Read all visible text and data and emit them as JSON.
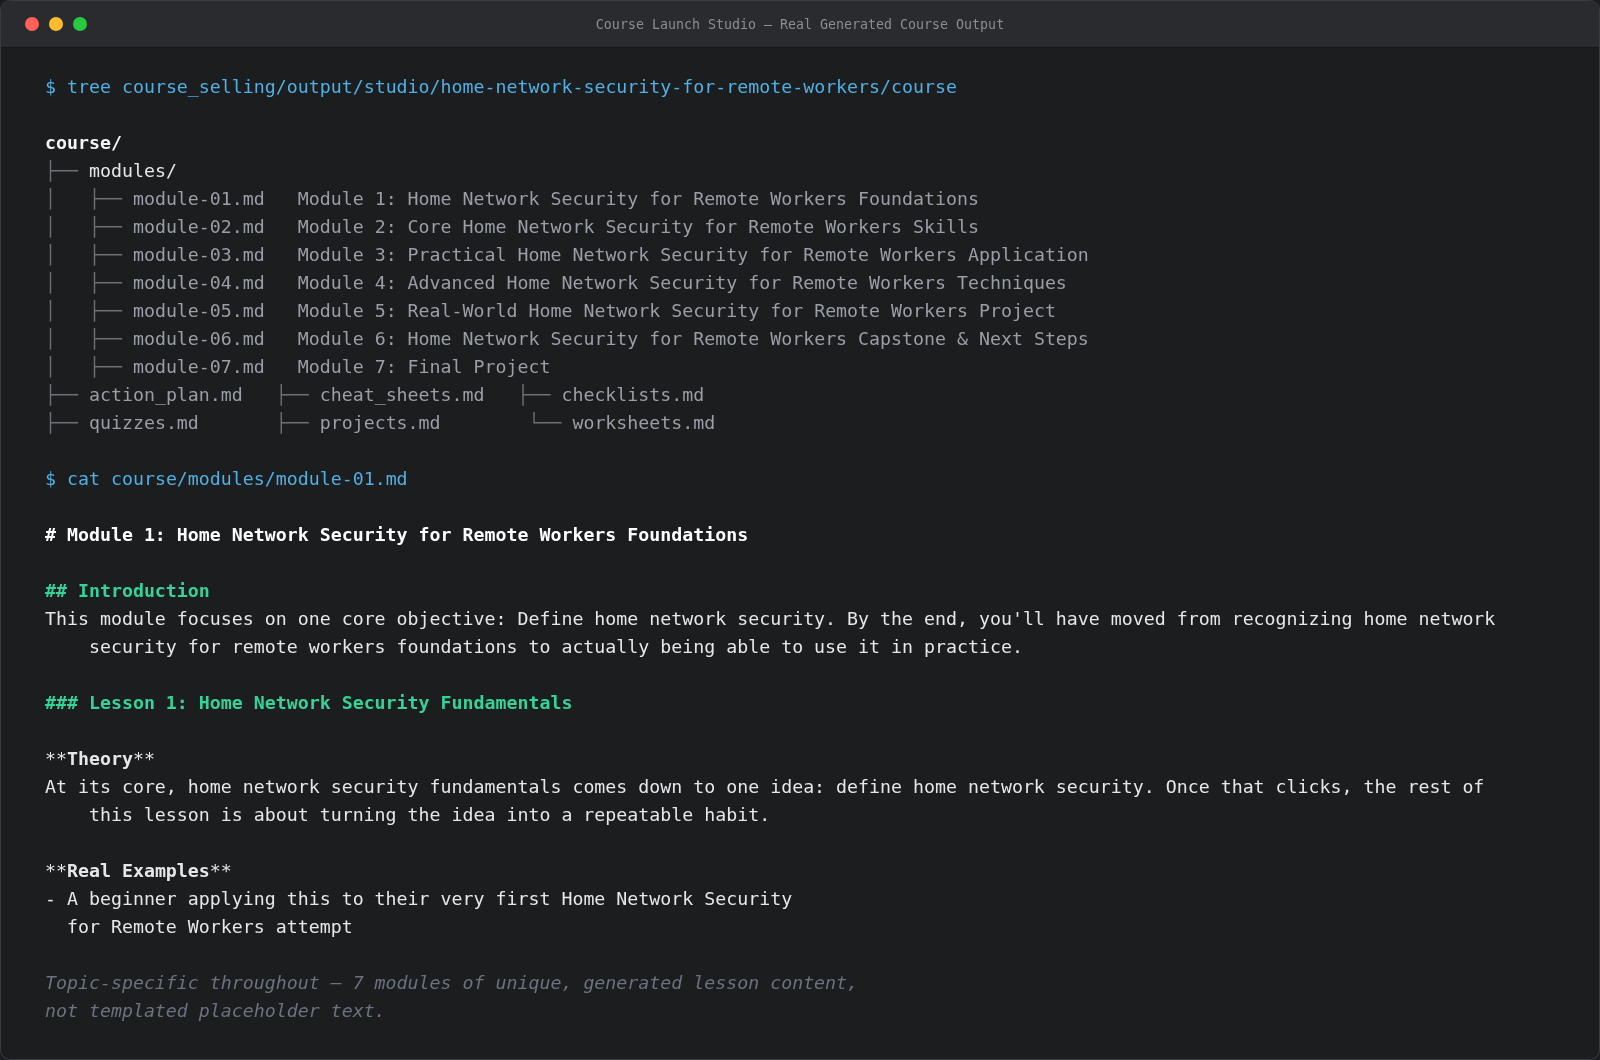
{
  "window": {
    "title": "Course Launch Studio — Real Generated Course Output"
  },
  "blocks": [
    {
      "kind": "command",
      "prompt": "$",
      "text": "tree course_selling/output/studio/home-network-security-for-remote-workers/course"
    },
    {
      "kind": "root",
      "text": "course/"
    },
    {
      "kind": "dir",
      "branch": "├──",
      "name": "modules/"
    },
    {
      "kind": "file",
      "branch": "│   ├──",
      "name": "module-01.md",
      "description": "Module 1: Home Network Security for Remote Workers Foundations"
    },
    {
      "kind": "file",
      "branch": "│   ├──",
      "name": "module-02.md",
      "description": "Module 2: Core Home Network Security for Remote Workers Skills"
    },
    {
      "kind": "file",
      "branch": "│   ├──",
      "name": "module-03.md",
      "description": "Module 3: Practical Home Network Security for Remote Workers Application"
    },
    {
      "kind": "file",
      "branch": "│   ├──",
      "name": "module-04.md",
      "description": "Module 4: Advanced Home Network Security for Remote Workers Techniques"
    },
    {
      "kind": "file",
      "branch": "│   ├──",
      "name": "module-05.md",
      "description": "Module 5: Real-World Home Network Security for Remote Workers Project"
    },
    {
      "kind": "file",
      "branch": "│   ├──",
      "name": "module-06.md",
      "description": "Module 6: Home Network Security for Remote Workers Capstone & Next Steps"
    },
    {
      "kind": "file",
      "branch": "│   ├──",
      "name": "module-07.md",
      "description": "Module 7: Final Project"
    },
    {
      "kind": "columns",
      "cells": [
        {
          "branch": "├──",
          "name": "action_plan.md"
        },
        {
          "branch": "├──",
          "name": "cheat_sheets.md"
        },
        {
          "branch": "├──",
          "name": "checklists.md"
        }
      ]
    },
    {
      "kind": "columns",
      "cells": [
        {
          "branch": "├──",
          "name": "quizzes.md"
        },
        {
          "branch": "├──",
          "name": "projects.md"
        },
        {
          "branch": " └──",
          "name": "worksheets.md"
        }
      ]
    },
    {
      "kind": "command",
      "prompt": "$",
      "text": "cat course/modules/module-01.md"
    },
    {
      "kind": "h1",
      "text": "# Module 1: Home Network Security for Remote Workers Foundations"
    },
    {
      "kind": "h2",
      "text": "## Introduction"
    },
    {
      "kind": "paragraph",
      "lines": [
        "This module focuses on one core objective: Define home network security. By the end, you'll have moved from recognizing home network",
        "security for remote workers foundations to actually being able to use it in practice."
      ]
    },
    {
      "kind": "h3",
      "text": "### Lesson 1: Home Network Security Fundamentals"
    },
    {
      "kind": "label",
      "open": "**",
      "text": "Theory",
      "close": "**"
    },
    {
      "kind": "paragraph",
      "lines": [
        "At its core, home network security fundamentals comes down to one idea: define home network security. Once that clicks, the rest of",
        "this lesson is about turning the idea into a repeatable habit."
      ]
    },
    {
      "kind": "label",
      "open": "**",
      "text": "Real Examples",
      "close": "**"
    },
    {
      "kind": "bullet",
      "lines": [
        "- A beginner applying this to their very first Home Network Security",
        "for Remote Workers attempt"
      ]
    },
    {
      "kind": "note",
      "lines": [
        "Topic-specific throughout — 7 modules of unique, generated lesson content,",
        "not templated placeholder text."
      ]
    }
  ]
}
